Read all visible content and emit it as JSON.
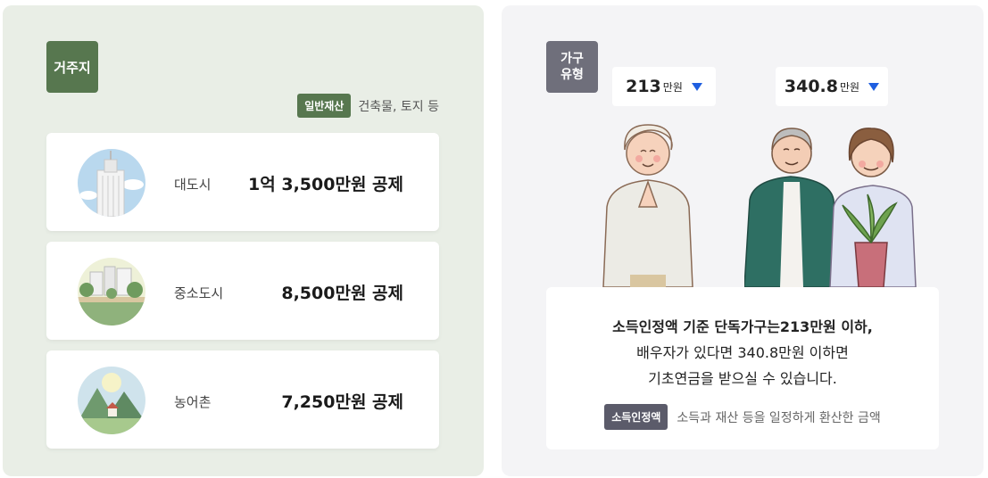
{
  "left_panel": {
    "tag": "거주지",
    "asset_chip": "일반재산",
    "asset_desc": "건축물, 토지 등",
    "cards": [
      {
        "label": "대도시",
        "amount": "1억 3,500만원 공제",
        "icon": "city-skyline-icon"
      },
      {
        "label": "중소도시",
        "amount": "8,500만원 공제",
        "icon": "small-town-icon"
      },
      {
        "label": "농어촌",
        "amount": "7,250만원 공제",
        "icon": "rural-village-icon"
      }
    ]
  },
  "right_panel": {
    "tag": "가구\n유형",
    "single": {
      "value": "213",
      "unit": "만원"
    },
    "couple": {
      "value": "340.8",
      "unit": "만원"
    },
    "info_lines": [
      "소득인정액 기준 단독가구는213만원 이하,",
      "배우자가 있다면 340.8만원 이하면",
      "기초연금을 받으실 수 있습니다."
    ],
    "def_chip": "소득인정액",
    "def_text": "소득과 재산 등을 일정하게 환산한 금액"
  },
  "colors": {
    "green": "#57774f",
    "gray_tag": "#6f6f7b",
    "caret_blue": "#1f5fe0"
  }
}
